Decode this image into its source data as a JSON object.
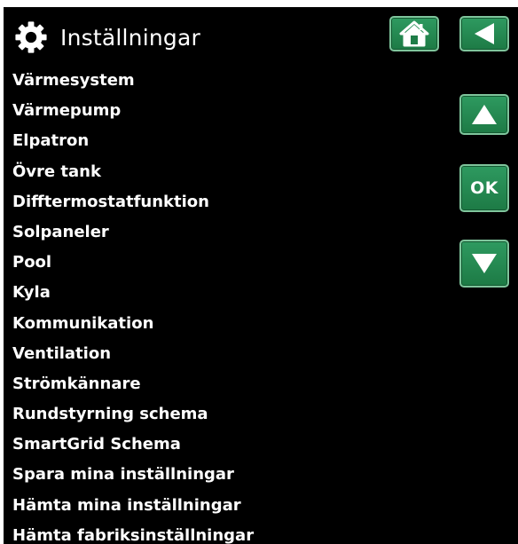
{
  "header": {
    "title": "Inställningar",
    "title_icon": "gear-icon"
  },
  "nav_buttons": {
    "home_icon": "home-icon",
    "back_icon": "back-arrow-icon",
    "up_icon": "up-arrow-icon",
    "ok_label": "OK",
    "down_icon": "down-arrow-icon"
  },
  "menu": {
    "items": [
      {
        "label": "Värmesystem"
      },
      {
        "label": "Värmepump"
      },
      {
        "label": "Elpatron"
      },
      {
        "label": "Övre tank"
      },
      {
        "label": "Difftermostatfunktion"
      },
      {
        "label": "Solpaneler"
      },
      {
        "label": "Pool"
      },
      {
        "label": "Kyla"
      },
      {
        "label": "Kommunikation"
      },
      {
        "label": "Ventilation"
      },
      {
        "label": "Strömkännare"
      },
      {
        "label": "Rundstyrning schema"
      },
      {
        "label": "SmartGrid Schema"
      },
      {
        "label": "Spara mina inställningar"
      },
      {
        "label": "Hämta mina inställningar"
      },
      {
        "label": "Hämta fabriksinställningar"
      }
    ]
  },
  "colors": {
    "background": "#000000",
    "text": "#ffffff",
    "button_green": "#238a52",
    "button_border": "#7fc59c"
  }
}
